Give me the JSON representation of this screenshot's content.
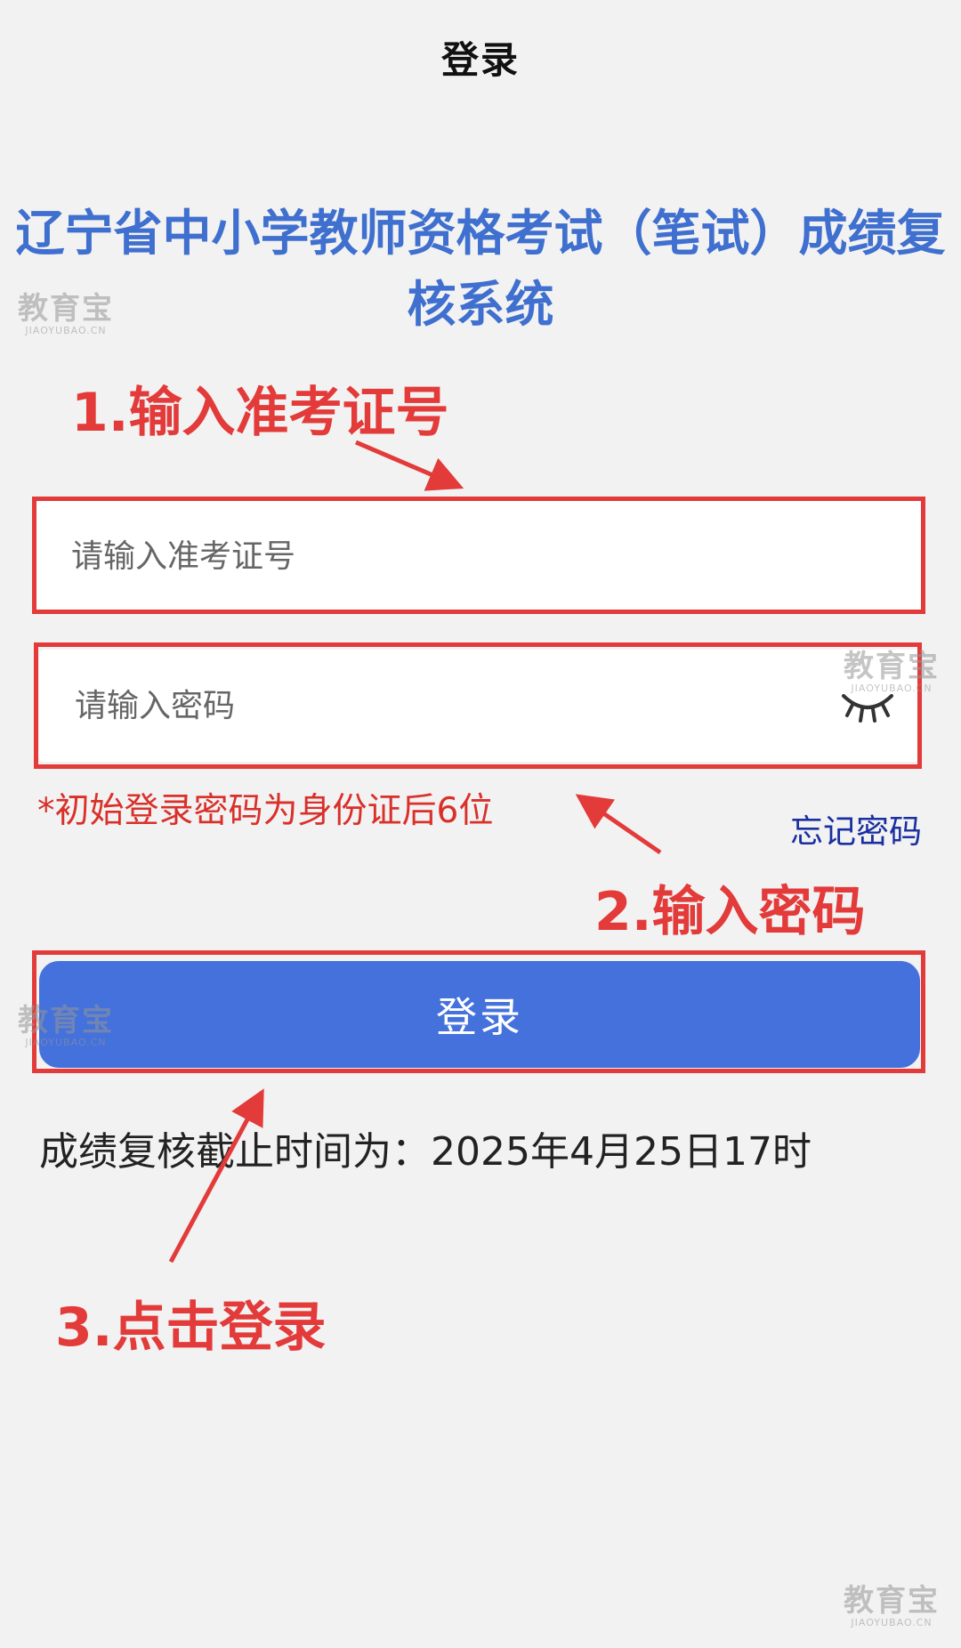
{
  "nav": {
    "title": "登录"
  },
  "system_title": "辽宁省中小学教师资格考试（笔试）成绩复核系统",
  "form": {
    "id_placeholder": "请输入准考证号",
    "password_placeholder": "请输入密码",
    "password_hint": "*初始登录密码为身份证后6位",
    "forgot_password": "忘记密码",
    "login_button": "登录"
  },
  "deadline_text": "成绩复核截止时间为：2025年4月25日17时",
  "annotations": {
    "step1": "1.输入准考证号",
    "step2": "2.输入密码",
    "step3": "3.点击登录"
  },
  "watermark": {
    "cn": "教育宝",
    "en": "JIAOYUBAO.CN"
  },
  "colors": {
    "background": "#f2f2f2",
    "title_blue": "#3f6fcf",
    "button_blue": "#4471dc",
    "annotation_red": "#e33a3a",
    "hint_red": "#d9302a",
    "link_blue": "#1a2fa0"
  },
  "icons": {
    "password_visibility": "eye-closed-icon"
  }
}
